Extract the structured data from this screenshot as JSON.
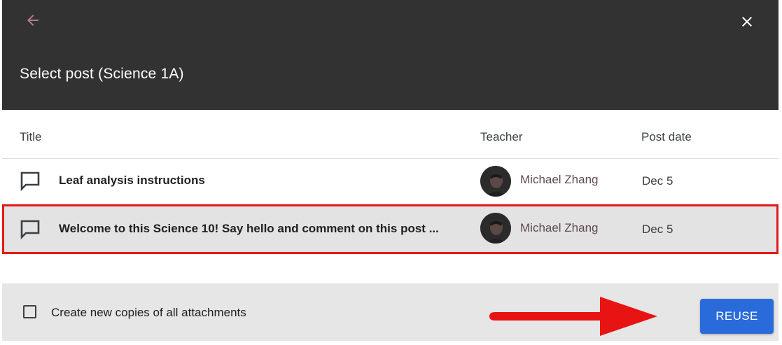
{
  "dialog": {
    "title": "Select post (Science 1A)",
    "back_icon": "arrow-back-icon",
    "close_icon": "close-icon"
  },
  "table": {
    "columns": [
      "Title",
      "Teacher",
      "Post date"
    ],
    "rows": [
      {
        "icon": "announcement-icon",
        "title": "Leaf analysis instructions",
        "teacher": "Michael Zhang",
        "post_date": "Dec 5",
        "selected": false
      },
      {
        "icon": "announcement-icon",
        "title": "Welcome to this Science 10! Say hello and comment on this post ...",
        "teacher": "Michael Zhang",
        "post_date": "Dec 5",
        "selected": true
      }
    ]
  },
  "footer": {
    "checkbox_label": "Create new copies of all attachments",
    "checkbox_checked": false,
    "reuse_label": "REUSE"
  },
  "colors": {
    "header_bg": "#323232",
    "selected_row_bg": "#e3e3e3",
    "highlight_red": "#e31b1b",
    "primary_button": "#2a6bdc",
    "footer_bg": "#e6e6e6"
  }
}
